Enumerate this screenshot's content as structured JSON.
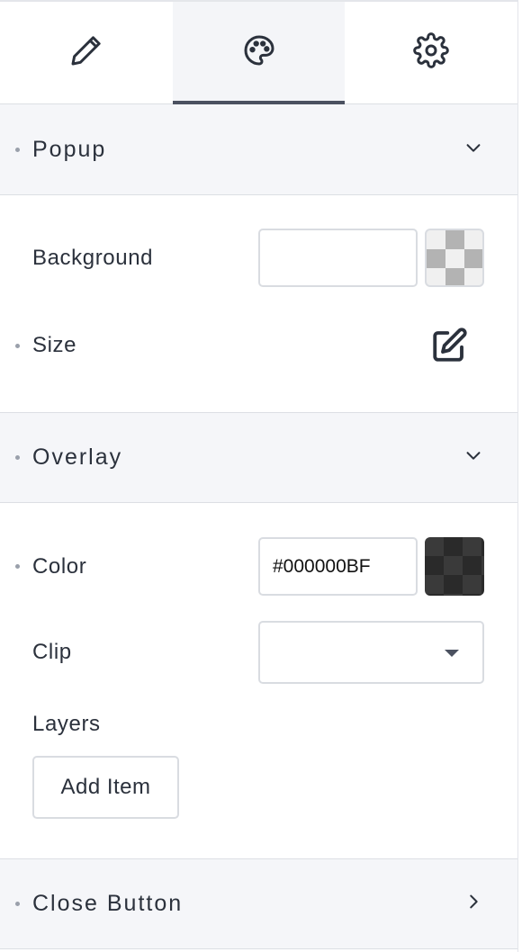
{
  "tabs": [
    {
      "icon": "pencil-icon",
      "active": false
    },
    {
      "icon": "palette-icon",
      "active": true
    },
    {
      "icon": "gear-icon",
      "active": false
    }
  ],
  "popup": {
    "title": "Popup",
    "background_label": "Background",
    "background_value": "",
    "size_label": "Size"
  },
  "overlay": {
    "title": "Overlay",
    "color_label": "Color",
    "color_value": "#000000BF",
    "clip_label": "Clip",
    "clip_value": "",
    "layers_label": "Layers",
    "add_item_label": "Add Item"
  },
  "close_button": {
    "title": "Close Button"
  },
  "colors": {
    "tab_active_indicator": "#4b5160",
    "header_bg": "#f5f6f9",
    "text": "#2b313c"
  }
}
